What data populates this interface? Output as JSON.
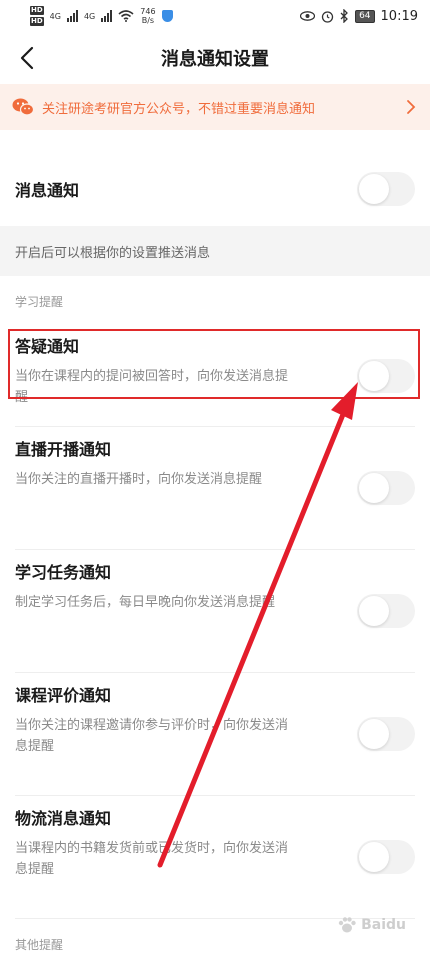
{
  "status_bar": {
    "hd1": "HD",
    "hd2": "HD",
    "net1": "4G",
    "net2": "4G",
    "speed_value": "746",
    "speed_unit": "B/s",
    "battery": "64",
    "time": "10:19"
  },
  "header": {
    "title": "消息通知设置"
  },
  "banner": {
    "text": "关注研途考研官方公众号，不错过重要消息通知"
  },
  "master": {
    "label": "消息通知",
    "enabled": false,
    "hint": "开启后可以根据你的设置推送消息"
  },
  "study_section": {
    "label": "学习提醒",
    "items": [
      {
        "title": "答疑通知",
        "desc": "当你在课程内的提问被回答时，向你发送消息提醒",
        "enabled": false
      },
      {
        "title": "直播开播通知",
        "desc": "当你关注的直播开播时，向你发送消息提醒",
        "enabled": false
      },
      {
        "title": "学习任务通知",
        "desc": "制定学习任务后，每日早晚向你发送消息提醒",
        "enabled": false
      },
      {
        "title": "课程评价通知",
        "desc": "当你关注的课程邀请你参与评价时，向你发送消息提醒",
        "enabled": false
      },
      {
        "title": "物流消息通知",
        "desc": "当课程内的书籍发货前或已发货时，向你发送消息提醒",
        "enabled": false
      }
    ]
  },
  "other_section": {
    "label": "其他提醒"
  },
  "watermark": {
    "text": "Baidu"
  },
  "colors": {
    "accent": "#f06c3c",
    "banner_bg": "#fdf0ea",
    "highlight": "#e02a2a"
  }
}
